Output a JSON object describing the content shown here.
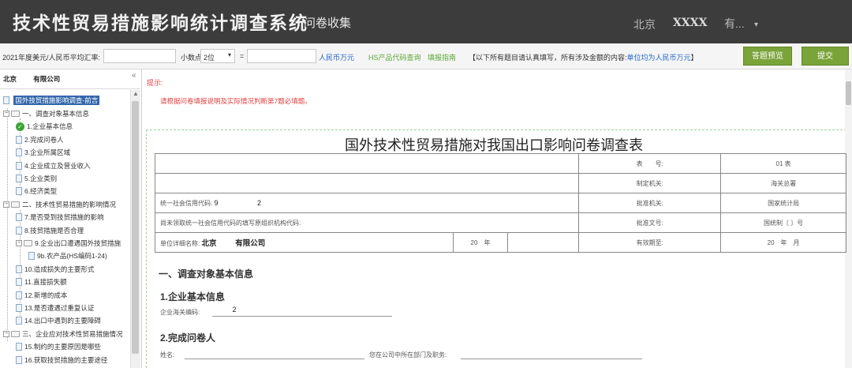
{
  "header": {
    "title": "技术性贸易措施影响统计调查系统",
    "tab": "问卷收集",
    "city": "北京",
    "user": "XXXX",
    "more": "有...",
    "caret": "▾"
  },
  "toolbar": {
    "rate_label": "2021年度美元/人民币平均汇率:",
    "rate_value": "",
    "decimal_label": "小数点",
    "decimal_selected": "2位",
    "equals": "=",
    "result_value": "",
    "rmb_unit": "人民币万元",
    "hs_link": "HS产品代码查询",
    "guide_link": "填报指南",
    "notice_prefix": "【以下所有题目请认真填写，所有涉及金额的内容:",
    "notice_highlight": "单位均为人民币万元",
    "notice_suffix": "】",
    "preview_button": "答题预览",
    "submit_button": "提交"
  },
  "sidebar": {
    "company": "北京     有限公司",
    "collapse_icon": "«",
    "root": "国外技贸措施影响调查-前言",
    "items": [
      {
        "label": "一、调查对象基本信息",
        "type": "folder",
        "level": 1
      },
      {
        "label": "1.企业基本信息",
        "type": "done",
        "level": 2
      },
      {
        "label": "2.完成问卷人",
        "type": "doc",
        "level": 2
      },
      {
        "label": "3.企业所属区域",
        "type": "doc",
        "level": 2
      },
      {
        "label": "4.企业成立及营业收入",
        "type": "doc",
        "level": 2
      },
      {
        "label": "5.企业类别",
        "type": "doc",
        "level": 2
      },
      {
        "label": "6.经济类型",
        "type": "doc",
        "level": 2
      },
      {
        "label": "二、技术性贸易措施的影响情况",
        "type": "folder",
        "level": 1
      },
      {
        "label": "7.是否受到技贸措施的影响",
        "type": "doc",
        "level": 2
      },
      {
        "label": "8.技贸措施是否合理",
        "type": "doc",
        "level": 2
      },
      {
        "label": "9.企业出口遭遇国外技贸措施",
        "type": "folder",
        "level": 2
      },
      {
        "label": "9b.农产品(HS编码1-24)",
        "type": "doc",
        "level": 3
      },
      {
        "label": "10.造成损失的主要形式",
        "type": "doc",
        "level": 2
      },
      {
        "label": "11.直接损失额",
        "type": "doc",
        "level": 2
      },
      {
        "label": "12.新增的成本",
        "type": "doc",
        "level": 2
      },
      {
        "label": "13.是否遭遇过重复认证",
        "type": "doc",
        "level": 2
      },
      {
        "label": "14.出口中遇到的主要障碍",
        "type": "doc",
        "level": 2
      },
      {
        "label": "三、企业应对技术性贸易措施情况",
        "type": "folder",
        "level": 1
      },
      {
        "label": "15.制约的主要原因是哪些",
        "type": "doc",
        "level": 2
      },
      {
        "label": "16.获取技贸措施的主要途径",
        "type": "doc",
        "level": 2
      }
    ]
  },
  "main": {
    "tip_label": "提示:",
    "tip_text": "请根据问卷填报说明及实际情况判断第7题必填题。",
    "doc_title": "国外技术性贸易措施对我国出口影响问卷调查表",
    "table": {
      "r1": {
        "k": "表　　号:",
        "v": "01 表"
      },
      "r2": {
        "k": "制定机关:",
        "v": "海关总署"
      },
      "r3": {
        "left_label": "统一社会信用代码:",
        "left_value": "9           2",
        "k": "批准机关:",
        "v": "国家统计局"
      },
      "r4": {
        "left_label": "尚未领取统一社会信用代码的填写原组织机构代码:",
        "k": "批准文号:",
        "v": "国统制〔 〕号"
      },
      "r5": {
        "left_label": "单位详细名称:",
        "left_value": "北京     有限公司",
        "year": "20　年",
        "k": "有效期至:",
        "v": "20　年　月"
      }
    },
    "section1": "一、调查对象基本信息",
    "sub1": "1.企业基本信息",
    "field_customs_label": "企业海关编码:",
    "field_customs_value": "     2",
    "sub2": "2.完成问卷人",
    "field_name_label": "姓名:",
    "field_dept_label": "您在公司中所在部门及职务:"
  }
}
